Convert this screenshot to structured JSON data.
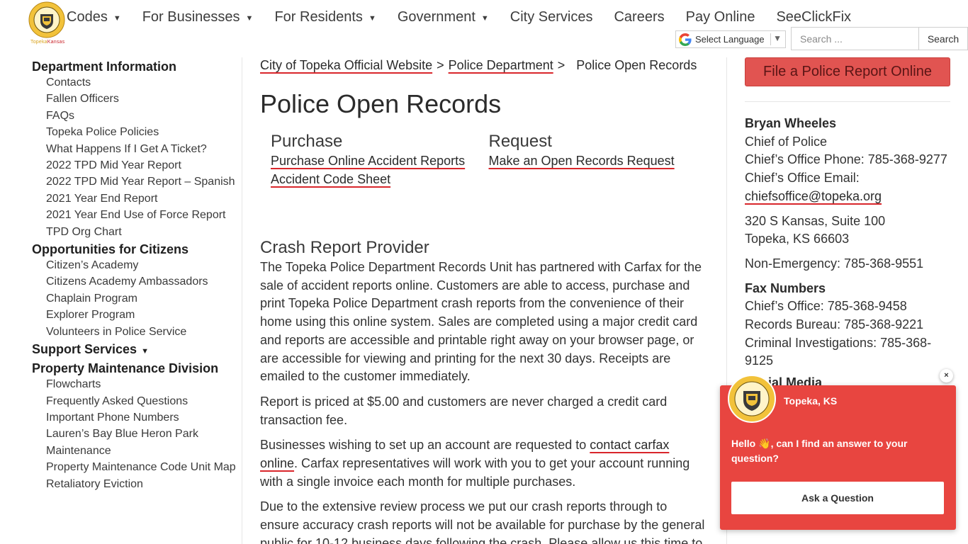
{
  "header": {
    "logo_tag_a": "Topeka",
    "logo_tag_b": "Kansas",
    "nav": [
      {
        "label": "Codes",
        "dropdown": true
      },
      {
        "label": "For Businesses",
        "dropdown": true
      },
      {
        "label": "For Residents",
        "dropdown": true
      },
      {
        "label": "Government",
        "dropdown": true
      },
      {
        "label": "City Services",
        "dropdown": false
      },
      {
        "label": "Careers",
        "dropdown": false
      },
      {
        "label": "Pay Online",
        "dropdown": false
      },
      {
        "label": "SeeClickFix",
        "dropdown": false
      }
    ],
    "translate_label": "Select Language",
    "search_placeholder": "Search ...",
    "search_button": "Search"
  },
  "sidebar": {
    "sections": [
      {
        "title": "Department Information",
        "items": [
          "Contacts",
          "Fallen Officers",
          "FAQs",
          "Topeka Police Policies",
          "What Happens If I Get A Ticket?",
          "2022 TPD Mid Year Report",
          "2022 TPD Mid Year Report – Spanish",
          "2021 Year End Report",
          "2021 Year End Use of Force Report",
          "TPD Org Chart"
        ]
      },
      {
        "title": "Opportunities for Citizens",
        "items": [
          "Citizen’s Academy",
          "Citizens Academy Ambassadors",
          "Chaplain Program",
          "Explorer Program",
          "Volunteers in Police Service"
        ]
      },
      {
        "title": "Support Services",
        "dropdown": true,
        "items": []
      },
      {
        "title": "Property Maintenance Division",
        "items": [
          "Flowcharts",
          "Frequently Asked Questions",
          "Important Phone Numbers",
          "Lauren’s Bay Blue Heron Park Maintenance",
          "Property Maintenance Code Unit Map",
          "Retaliatory Eviction"
        ]
      }
    ]
  },
  "main": {
    "breadcrumb": {
      "home": "City of Topeka Official Website",
      "parent": "Police Department",
      "current": "Police Open Records",
      "sep": ">"
    },
    "title": "Police Open Records",
    "purchase": {
      "heading": "Purchase",
      "links": [
        "Purchase Online Accident Reports",
        "Accident Code Sheet"
      ]
    },
    "request": {
      "heading": "Request",
      "links": [
        "Make an Open Records Request"
      ]
    },
    "section_heading": "Crash Report Provider",
    "p1": "The Topeka Police Department Records Unit has partnered with Carfax for the sale of accident reports online. Customers are able to access, purchase and print Topeka Police Department crash reports from the convenience of their home using this online system. Sales are completed using a major credit card and reports are accessible and printable right away on your browser page, or are accessible for viewing and printing for the next 30 days. Receipts are emailed to the customer immediately.",
    "p2": "Report is priced at $5.00 and customers are never charged a credit card transaction fee.",
    "p3_before": "Businesses wishing to set up an account are requested to ",
    "p3_link": "contact carfax online",
    "p3_after": ". Carfax representatives will work with you to get your account running with a single invoice each month for multiple purchases.",
    "p4": "Due to the extensive review process we put our crash reports through to ensure accuracy crash reports will not be available for purchase by the general public for 10-12 business days following the crash. Please allow us this time to"
  },
  "right": {
    "report_button": "File a Police Report Online",
    "chief_name": "Bryan Wheeles",
    "chief_title": "Chief of Police",
    "chief_phone": "Chief’s Office Phone: 785-368-9277",
    "chief_email_label": "Chief’s Office Email:",
    "chief_email": "chiefsoffice@topeka.org",
    "address1": "320 S Kansas, Suite 100",
    "address2": "Topeka, KS 66603",
    "non_emergency": "Non-Emergency: 785-368-9551",
    "fax_heading": "Fax Numbers",
    "fax_chief": "Chief’s Office: 785-368-9458",
    "fax_records": "Records Bureau: 785-368-9221",
    "fax_criminal": "Criminal Investigations: 785-368-9125",
    "social_heading": "Social Media"
  },
  "chat": {
    "name": "Topeka, KS",
    "message_a": "Hello",
    "message_b": ", can I find an answer to your question?",
    "button": "Ask a Question",
    "close": "×"
  },
  "colors": {
    "accent_red": "#d9262b",
    "button_red": "#e15451",
    "chat_red": "#e84540",
    "seal_gold": "#f2c23a"
  }
}
